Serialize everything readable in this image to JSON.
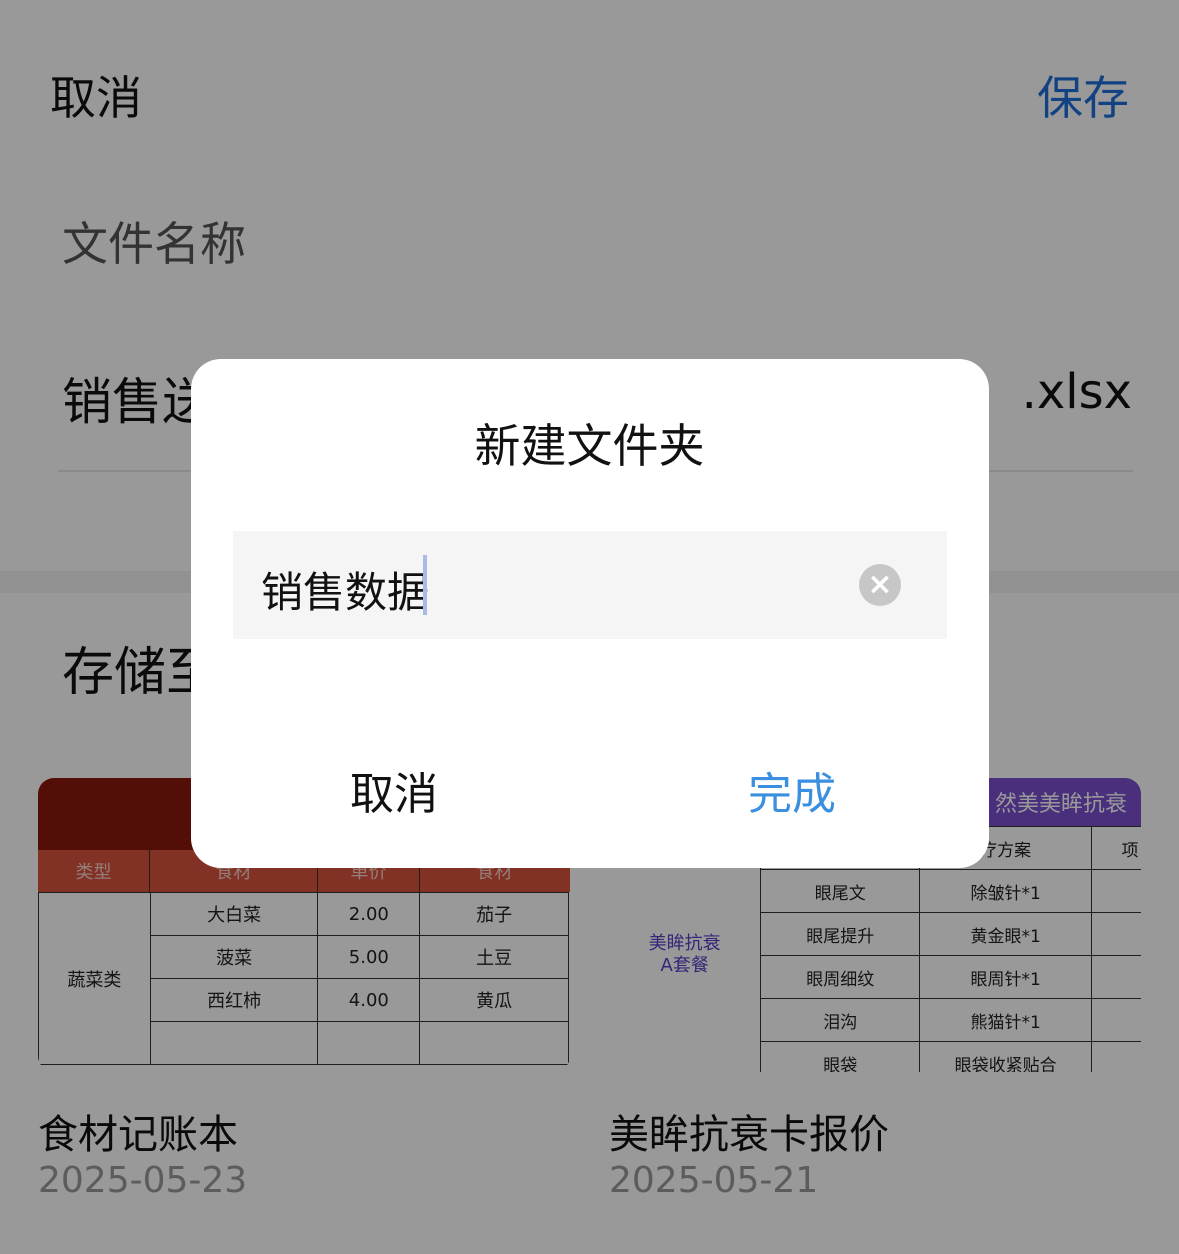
{
  "nav": {
    "cancel_label": "取消",
    "save_label": "保存"
  },
  "filename": {
    "label": "文件名称",
    "value": "销售送",
    "extension": ".xlsx"
  },
  "save_to": {
    "label": "存储至"
  },
  "templates": [
    {
      "title": "食材记账本",
      "date": "2025-05-23",
      "thumbnail": {
        "columns": [
          "类型",
          "食材",
          "单价",
          "食材"
        ],
        "category": "蔬菜类",
        "rows": [
          [
            "大白菜",
            "2.00",
            "茄子"
          ],
          [
            "菠菜",
            "5.00",
            "土豆"
          ],
          [
            "西红柿",
            "4.00",
            "黄瓜"
          ]
        ]
      }
    },
    {
      "title": "美眸抗衰卡报价",
      "date": "2025-05-21",
      "thumbnail": {
        "header": "然美美眸抗衰",
        "column": "疗方案",
        "column2": "项",
        "combo_line1": "美眸抗衰",
        "combo_line2": "A套餐",
        "rows": [
          [
            "眼尾文",
            "除皱针*1"
          ],
          [
            "眼尾提升",
            "黄金眼*1"
          ],
          [
            "眼周细纹",
            "眼周针*1"
          ],
          [
            "泪沟",
            "熊猫针*1"
          ],
          [
            "眼袋",
            "眼袋收紧贴合"
          ]
        ]
      }
    }
  ],
  "dialog": {
    "title": "新建文件夹",
    "input_value": "销售数据",
    "cancel_label": "取消",
    "done_label": "完成"
  },
  "colors": {
    "save_blue": "#1e6fd9",
    "done_blue": "#3b8fe0",
    "thumb1_header": "#8b1a0d",
    "thumb2_header": "#7a4fcf"
  }
}
